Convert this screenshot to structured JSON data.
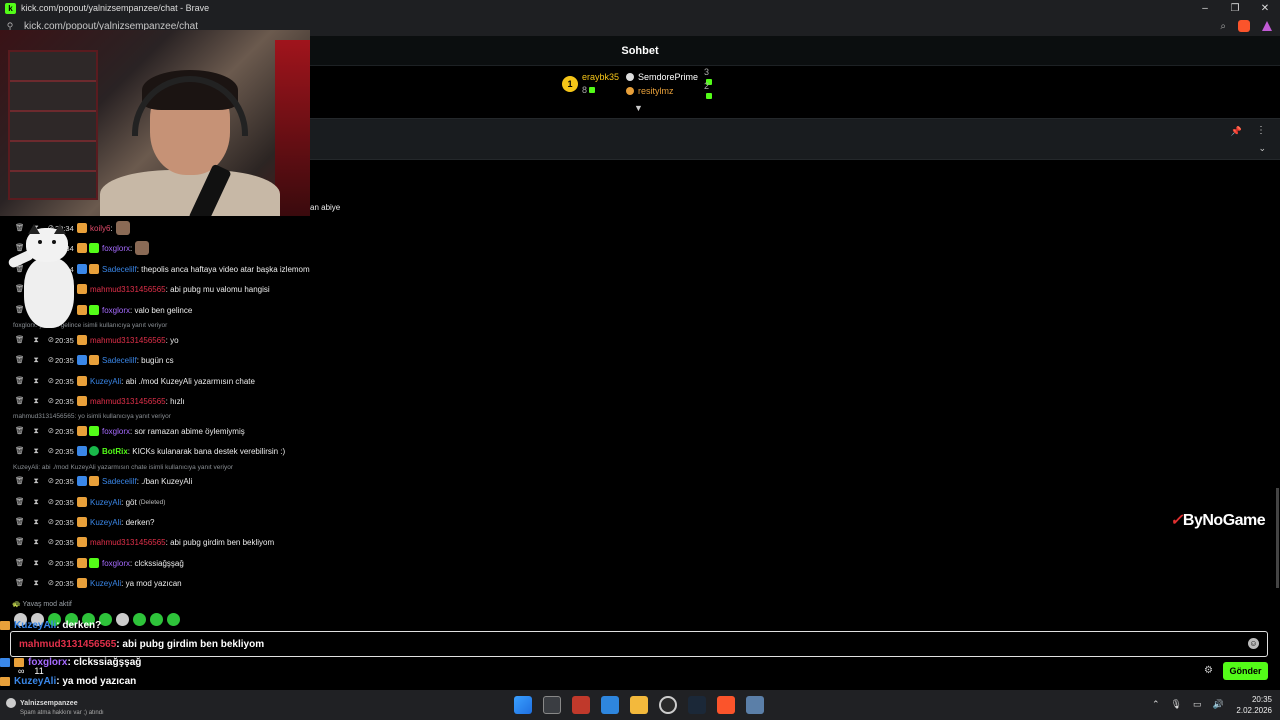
{
  "window": {
    "title": "kick.com/popout/yalnizsempanzee/chat - Brave",
    "minimize": "–",
    "restore": "❐",
    "close": "✕"
  },
  "browser": {
    "url": "kick.com/popout/yalnizsempanzee/chat"
  },
  "chat_header": {
    "title": "Sohbet"
  },
  "leaderboard": {
    "first": {
      "rank": "1",
      "name": "eraybk35",
      "count": "8"
    },
    "rows": [
      {
        "name": "SemdorePrime",
        "count": "3",
        "color": "#ffffff"
      },
      {
        "name": "resitylmz",
        "count": "2",
        "color": "#e8a03a"
      }
    ]
  },
  "pinned": {
    "pin_icon": "pin-icon",
    "more_icon": "more-vertical-icon",
    "chevron_icon": "chevron-down-icon"
  },
  "partial_text": "an abiye",
  "messages": [
    {
      "time": "20:34",
      "user": "koily6",
      "color": "#e04b6a",
      "text": ":",
      "badges": [
        "og"
      ],
      "emote": true
    },
    {
      "time": "20:34",
      "user": "foxglorx",
      "color": "#a66bff",
      "text": ":",
      "badges": [
        "og",
        "green"
      ],
      "emote": true
    },
    {
      "time": "20:34",
      "user": "Sadecelilf",
      "color": "#3a87e8",
      "text": ": thepolis anca haftaya video atar başka izlemom",
      "badges": [
        "blue",
        "og"
      ]
    },
    {
      "time": "",
      "user": "mahmud3131456565",
      "color": "#e0304a",
      "text": ": abi pubg mu valomu hangisi",
      "badges": [
        "og"
      ]
    },
    {
      "time": "",
      "user": "foxglorx",
      "color": "#a66bff",
      "text": ": valo ben gelince",
      "badges": [
        "og",
        "green"
      ]
    },
    {
      "time": "20:35",
      "user": "mahmud3131456565",
      "color": "#e0304a",
      "text": ": yo",
      "badges": [
        "og"
      ]
    },
    {
      "time": "20:35",
      "user": "Sadecelilf",
      "color": "#3a87e8",
      "text": ": bugün cs",
      "badges": [
        "blue",
        "og"
      ]
    },
    {
      "time": "20:35",
      "user": "KuzeyAli",
      "color": "#3a87e8",
      "text": ": abi ./mod KuzeyAli yazarmısın chate",
      "badges": [
        "og"
      ]
    },
    {
      "time": "20:35",
      "user": "mahmud3131456565",
      "color": "#e0304a",
      "text": ": hızlı",
      "badges": [
        "og"
      ]
    },
    {
      "time": "20:35",
      "user": "foxglorx",
      "color": "#a66bff",
      "text": ": sor ramazan abime öylemiymiş",
      "badges": [
        "og",
        "green"
      ]
    },
    {
      "time": "20:35",
      "user": "BotRix",
      "color": "#53fc18",
      "text": ": KICKs kulanarak bana destek verebilirsin :)",
      "badges": [
        "blue",
        "bot"
      ]
    },
    {
      "time": "20:35",
      "user": "Sadecelilf",
      "color": "#3a87e8",
      "text": ": ./ban KuzeyAli",
      "badges": [
        "blue",
        "og"
      ]
    },
    {
      "time": "20:35",
      "user": "KuzeyAli",
      "color": "#3a87e8",
      "text": ": göt",
      "badges": [
        "og"
      ],
      "deleted": "(Deleted)"
    },
    {
      "time": "20:35",
      "user": "KuzeyAli",
      "color": "#3a87e8",
      "text": ": derken?",
      "badges": [
        "og"
      ]
    },
    {
      "time": "20:35",
      "user": "mahmud3131456565",
      "color": "#e0304a",
      "text": ": abi pubg girdim ben bekliyom",
      "badges": [
        "og"
      ]
    },
    {
      "time": "20:35",
      "user": "foxglorx",
      "color": "#a66bff",
      "text": ": clckssiağşşağ",
      "badges": [
        "og",
        "green"
      ]
    },
    {
      "time": "20:35",
      "user": "KuzeyAli",
      "color": "#3a87e8",
      "text": ": ya mod yazıcan",
      "badges": [
        "og"
      ]
    }
  ],
  "replies": [
    {
      "text": "foxglorx: yo ben gelince isimli kullanıcıya yanıt veriyor"
    },
    {
      "text": "mahmud3131456565: yo isimli kullanıcıya yanıt veriyor"
    },
    {
      "text": "KuzeyAli: abi ./mod KuzeyAli yazarmısın chate isimli kullanıcıya yanıt veriyor"
    }
  ],
  "slowmode": "Yavaş mod aktif",
  "input": {
    "mention": "mahmud3131456565",
    "text": ": abi pubg girdim ben bekliyom"
  },
  "send_label": "Gönder",
  "overlay": {
    "lines": [
      {
        "user": "KuzeyAli",
        "text": ": derken?",
        "color": "#3a87e8"
      },
      {
        "user": "foxglorx",
        "text": ": clckssiağşşağ",
        "color": "#a66bff"
      },
      {
        "user": "KuzeyAli",
        "text": ": ya mod yazıcan",
        "color": "#3a87e8"
      }
    ],
    "stat_infinity": "∞",
    "stat_count": "11"
  },
  "sponsor": {
    "mark": "✓",
    "name": "ByNoGame"
  },
  "taskbar": {
    "weather_title": "Yalnizsempanzee",
    "weather_sub": "Spam atma hakkını var ;) atındı",
    "clock_time": "20:35",
    "clock_date": "2.02.2026",
    "apps": [
      "windows-start-icon",
      "task-view-icon",
      "snipping-tool-icon",
      "photos-icon",
      "file-explorer-icon",
      "obs-icon",
      "steam-icon",
      "brave-icon",
      "other-app-icon"
    ]
  }
}
